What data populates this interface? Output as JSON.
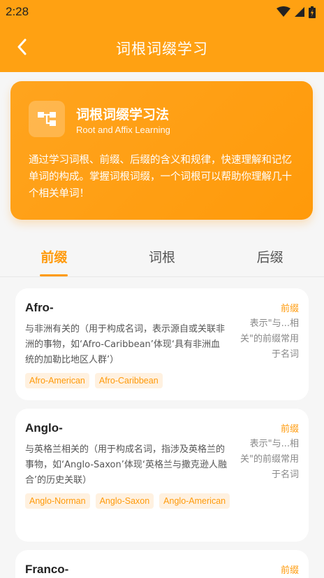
{
  "status": {
    "time": "2:28"
  },
  "nav": {
    "title": "词根词缀学习"
  },
  "hero": {
    "title": "词根词缀学习法",
    "subtitle": "Root and Affix Learning",
    "desc": "通过学习词根、前缀、后缀的含义和规律，快速理解和记忆单词的构成。掌握词根词缀，一个词根可以帮助你理解几十个相关单词！"
  },
  "tabs": [
    {
      "label": "前缀"
    },
    {
      "label": "词根"
    },
    {
      "label": "后缀"
    }
  ],
  "cards": [
    {
      "word": "Afro-",
      "type": "前缀",
      "meaning": "与非洲有关的（用于构成名词，表示源自或关联非洲的事物，如‘Afro-Caribbean’体现‘具有非洲血统的加勒比地区人群’）",
      "note": "表示\"与...相关\"的前缀常用于名词",
      "tags": [
        "Afro-American",
        "Afro-Caribbean"
      ]
    },
    {
      "word": "Anglo-",
      "type": "前缀",
      "meaning": "与英格兰相关的（用于构成名词，指涉及英格兰的事物，如‘Anglo-Saxon’体现‘英格兰与撒克逊人融合’的历史关联）",
      "note": "表示\"与...相关\"的前缀常用于名词",
      "tags": [
        "Anglo-Norman",
        "Anglo-Saxon",
        "Anglo-American"
      ]
    },
    {
      "word": "Franco-",
      "type": "前缀"
    }
  ]
}
